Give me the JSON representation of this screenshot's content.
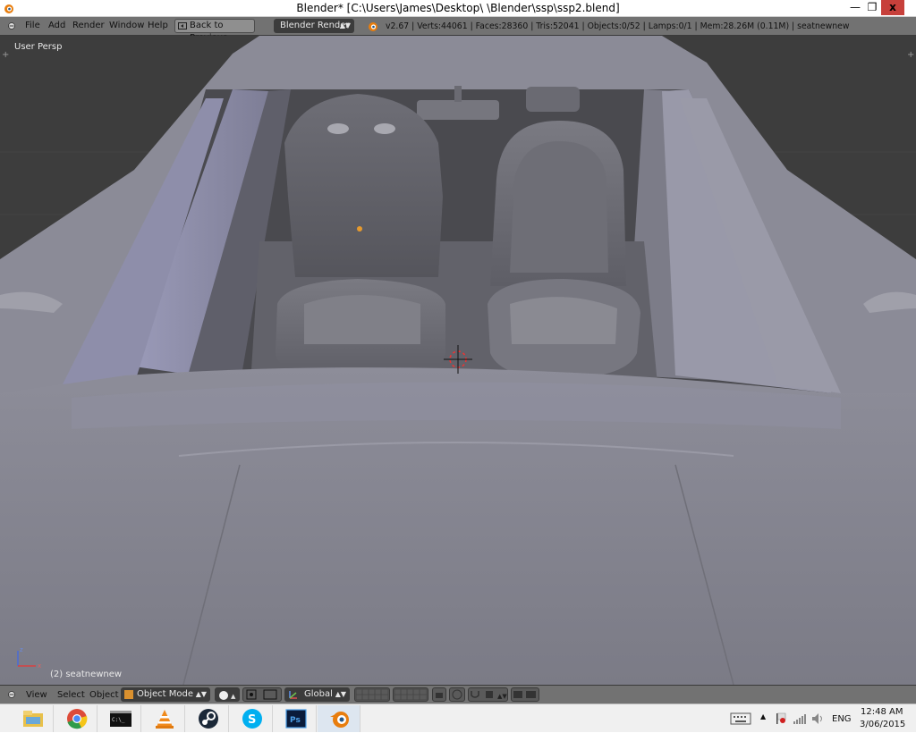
{
  "window": {
    "title": "Blender* [C:\\Users\\James\\Desktop\\ \\Blender\\ssp\\ssp2.blend]",
    "minimize": "—",
    "maximize": "❐",
    "close": "x"
  },
  "info_header": {
    "menus": [
      "File",
      "Add",
      "Render",
      "Window",
      "Help"
    ],
    "back_button": "Back to Previous",
    "render_engine": "Blender Render",
    "stats": "v2.67 | Verts:44061 | Faces:28360 | Tris:52041 | Objects:0/52 | Lamps:0/1 | Mem:28.26M (0.11M) | seatnewnew"
  },
  "viewport": {
    "view_label": "User Persp",
    "object_label": "(2) seatnewnew",
    "axis_x": "x",
    "axis_z": "z"
  },
  "view_header": {
    "menus": [
      "View",
      "Select",
      "Object"
    ],
    "mode": "Object Mode",
    "orientation": "Global"
  },
  "taskbar": {
    "apps": [
      "file-explorer-icon",
      "chrome-icon",
      "terminal-icon",
      "vlc-icon",
      "steam-icon",
      "skype-icon",
      "photoshop-icon",
      "blender-icon"
    ],
    "photoshop_text": "Ps",
    "terminal_text": "C:\\_",
    "language": "ENG",
    "time": "12:48 AM",
    "date": "3/06/2015"
  },
  "colors": {
    "viewport_bg": "#3d3d3d",
    "header_bg": "#727272",
    "model_gray": "#8a8a9a",
    "close_red": "#c7403b",
    "taskbar_bg": "#f0f0f0"
  }
}
